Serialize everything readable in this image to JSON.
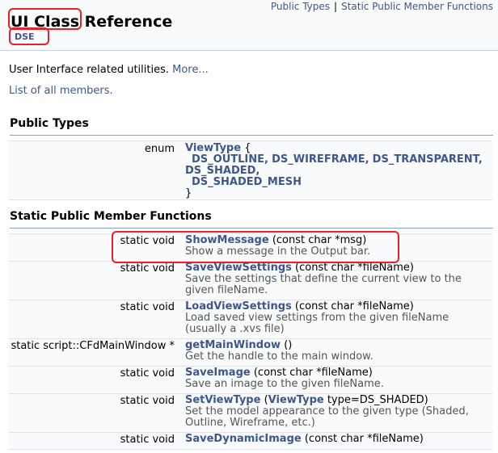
{
  "header": {
    "nav": [
      "Public Types",
      "Static Public Member Functions"
    ],
    "nav_separator": "|",
    "title": "UI Class Reference",
    "ingroup": "DSE"
  },
  "brief": {
    "text": "User Interface related utilities.",
    "more": "More..."
  },
  "all_members": "List of all members.",
  "public_types": {
    "heading": "Public Types",
    "enum": {
      "left": "enum",
      "name": "ViewType",
      "open": "{",
      "values": [
        "DS_OUTLINE,",
        "DS_WIREFRAME,",
        "DS_TRANSPARENT,",
        "DS_SHADED,",
        "DS_SHADED_MESH"
      ],
      "close": "}"
    }
  },
  "static_functions": {
    "heading": "Static Public Member Functions",
    "items": [
      {
        "ret": "static void",
        "name": "ShowMessage",
        "args": " (const char *msg)",
        "desc": "Show a message in the Output bar."
      },
      {
        "ret": "static void",
        "name": "SaveViewSettings",
        "args": " (const char *fileName)",
        "desc": "Save the settings that define the current view to the given fileName."
      },
      {
        "ret": "static void",
        "name": "LoadViewSettings",
        "args": " (const char *fileName)",
        "desc": "Load saved view settings from the given fileName (usually a .xvs file)"
      },
      {
        "ret": "static script::CFdMainWindow *",
        "name": "getMainWindow",
        "args": " ()",
        "desc": "Get the handle to the main window."
      },
      {
        "ret": "static void",
        "name": "SaveImage",
        "args": " (const char *fileName)",
        "desc": "Save an image to the given fileName."
      },
      {
        "ret": "static void",
        "name": "SetViewType",
        "args_type": "ViewType",
        "args_open": " (",
        "args_rest": " type=DS_SHADED)",
        "desc": "Set the model appearance to the given type (Shaded, Outline, Wireframe, etc.)"
      },
      {
        "ret": "static void",
        "name": "SaveDynamicImage",
        "args": " (const char *fileName)",
        "desc": ""
      }
    ]
  },
  "colors": {
    "link": "#3d578c",
    "highlight": "#e8202a",
    "header_bg": "#f9fafc"
  }
}
